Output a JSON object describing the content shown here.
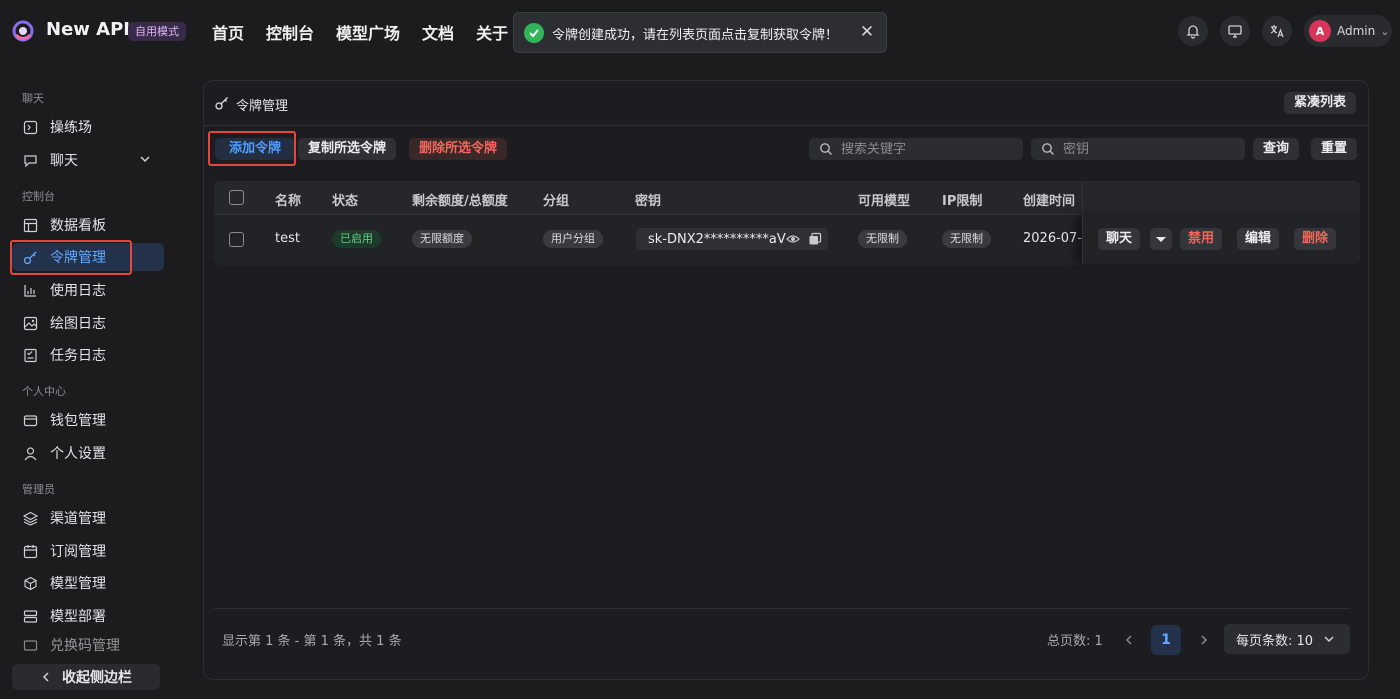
{
  "brand": {
    "name": "New API",
    "mode": "自用模式"
  },
  "nav": [
    "首页",
    "控制台",
    "模型广场",
    "文档",
    "关于"
  ],
  "toast": {
    "message": "令牌创建成功，请在列表页面点击复制获取令牌！"
  },
  "user": {
    "initial": "A",
    "name": "Admin"
  },
  "sidebar": {
    "sections": [
      {
        "label": "聊天",
        "items": [
          {
            "label": "操练场",
            "icon": "playground-icon"
          },
          {
            "label": "聊天",
            "icon": "chat-icon",
            "expandable": true
          }
        ]
      },
      {
        "label": "控制台",
        "items": [
          {
            "label": "数据看板",
            "icon": "dashboard-icon"
          },
          {
            "label": "令牌管理",
            "icon": "key-icon",
            "active": true
          },
          {
            "label": "使用日志",
            "icon": "chart-icon"
          },
          {
            "label": "绘图日志",
            "icon": "image-icon"
          },
          {
            "label": "任务日志",
            "icon": "checklist-icon"
          }
        ]
      },
      {
        "label": "个人中心",
        "items": [
          {
            "label": "钱包管理",
            "icon": "wallet-icon"
          },
          {
            "label": "个人设置",
            "icon": "user-icon"
          }
        ]
      },
      {
        "label": "管理员",
        "items": [
          {
            "label": "渠道管理",
            "icon": "layers-icon"
          },
          {
            "label": "订阅管理",
            "icon": "calendar-icon"
          },
          {
            "label": "模型管理",
            "icon": "cube-icon"
          },
          {
            "label": "模型部署",
            "icon": "server-icon"
          },
          {
            "label": "兑换码管理",
            "icon": "ticket-icon"
          }
        ]
      }
    ],
    "collapse_label": "收起侧边栏"
  },
  "card": {
    "title": "令牌管理",
    "compact_button": "紧凑列表",
    "add_button": "添加令牌",
    "copy_selected_button": "复制所选令牌",
    "delete_selected_button": "删除所选令牌",
    "search_keyword_placeholder": "搜索关键字",
    "search_key_placeholder": "密钥",
    "query_button": "查询",
    "reset_button": "重置"
  },
  "table": {
    "headers": [
      "名称",
      "状态",
      "剩余额度/总额度",
      "分组",
      "密钥",
      "可用模型",
      "IP限制",
      "创建时间"
    ],
    "rows": [
      {
        "name": "test",
        "status": "已启用",
        "quota": "无限额度",
        "group": "用户分组",
        "key": "sk-DNX2**********aV",
        "models": "无限制",
        "ip": "无限制",
        "created": "2026-07-",
        "actions": {
          "chat": "聊天",
          "disable": "禁用",
          "edit": "编辑",
          "delete": "删除"
        }
      }
    ]
  },
  "footer": {
    "info": "显示第 1 条 - 第 1 条，共 1 条",
    "total_pages": "总页数: 1",
    "current_page": "1",
    "per_page": "每页条数: 10"
  }
}
